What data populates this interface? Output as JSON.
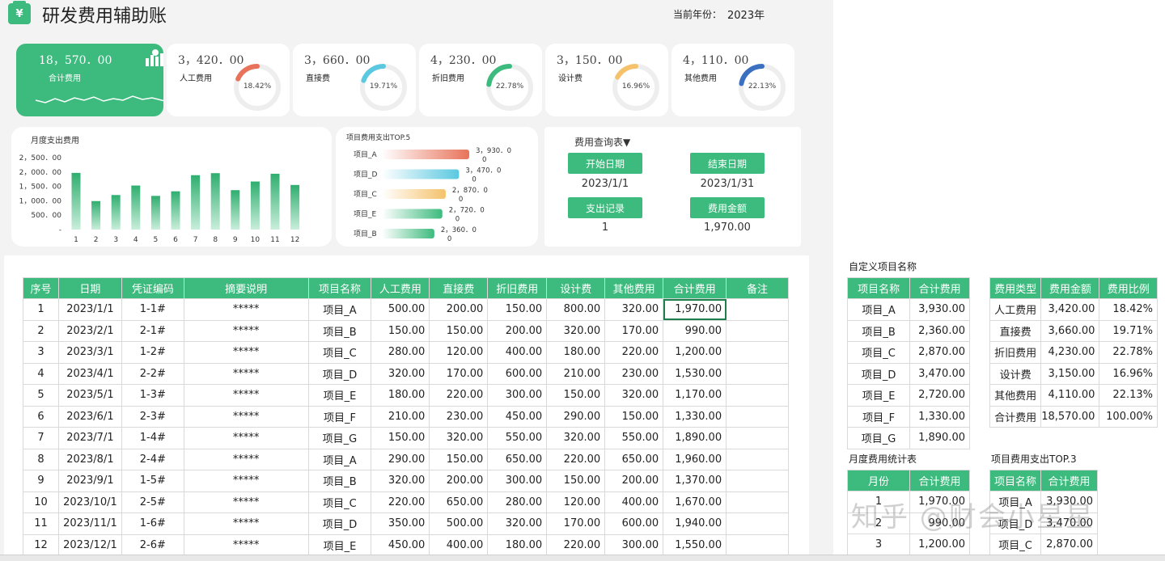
{
  "header": {
    "logo_glyph": "¥",
    "title": "研发费用辅助账",
    "year_label": "当前年份：",
    "year_value": "2023年"
  },
  "kpis": {
    "total": {
      "amount": "18，570．00",
      "label": "合计费用"
    },
    "items": [
      {
        "amount": "3，420．00",
        "label": "人工费用",
        "pct": "18.42%",
        "ratio": 0.1842,
        "color": "#e8735a"
      },
      {
        "amount": "3，660．00",
        "label": "直接费",
        "pct": "19.71%",
        "ratio": 0.1971,
        "color": "#5ac8e0"
      },
      {
        "amount": "4，230．00",
        "label": "折旧费用",
        "pct": "22.78%",
        "ratio": 0.2278,
        "color": "#3dbb7e"
      },
      {
        "amount": "3，150．00",
        "label": "设计费",
        "pct": "16.96%",
        "ratio": 0.1696,
        "color": "#f5c26b"
      },
      {
        "amount": "4，110．00",
        "label": "其他费用",
        "pct": "22.13%",
        "ratio": 0.2213,
        "color": "#3b6fc0"
      }
    ]
  },
  "chart_data": [
    {
      "type": "bar",
      "title": "月度支出费用",
      "categories": [
        "1",
        "2",
        "3",
        "4",
        "5",
        "6",
        "7",
        "8",
        "9",
        "10",
        "11",
        "12"
      ],
      "values": [
        1970,
        990,
        1200,
        1530,
        1170,
        1330,
        1890,
        1960,
        1370,
        1670,
        1940,
        1550
      ],
      "yticks": [
        "2，500．00",
        "2，000．00",
        "1，500．00",
        "1，000．00",
        "500．00",
        "-"
      ],
      "ylim": [
        0,
        2500
      ],
      "color": "#3dbb7e"
    },
    {
      "type": "bar",
      "orientation": "horizontal",
      "title": "项目费用支出TOP.5",
      "categories": [
        "项目_A",
        "项目_D",
        "项目_C",
        "项目_E",
        "项目_B"
      ],
      "values": [
        3930,
        3470,
        2870,
        2720,
        2360
      ],
      "value_labels": [
        [
          "3，930．0",
          "0"
        ],
        [
          "3，470．0",
          "0"
        ],
        [
          "2，870．0",
          "0"
        ],
        [
          "2，720．0",
          "0"
        ],
        [
          "2，360．0",
          "0"
        ]
      ],
      "colors": [
        "#e8735a",
        "#5ac8e0",
        "#f5c26b",
        "#3dbb7e",
        "#3dbb7e"
      ],
      "xlim": [
        0,
        3930
      ]
    }
  ],
  "query": {
    "title": "费用查询表▼",
    "start_label": "开始日期",
    "start_value": "2023/1/1",
    "end_label": "结束日期",
    "end_value": "2023/1/31",
    "records_label": "支出记录",
    "records_value": "1",
    "amount_label": "费用金额",
    "amount_value": "1,970.00"
  },
  "main_table": {
    "headers": [
      "序号",
      "日期",
      "凭证编码",
      "摘要说明",
      "项目名称",
      "人工费用",
      "直接费",
      "折旧费用",
      "设计费",
      "其他费用",
      "合计费用",
      "备注"
    ],
    "rows": [
      [
        "1",
        "2023/1/1",
        "1-1#",
        "*****",
        "项目_A",
        "500.00",
        "200.00",
        "150.00",
        "800.00",
        "320.00",
        "1,970.00",
        ""
      ],
      [
        "2",
        "2023/2/1",
        "2-1#",
        "*****",
        "项目_B",
        "150.00",
        "150.00",
        "200.00",
        "320.00",
        "170.00",
        "990.00",
        ""
      ],
      [
        "3",
        "2023/3/1",
        "1-2#",
        "*****",
        "项目_C",
        "280.00",
        "120.00",
        "400.00",
        "180.00",
        "220.00",
        "1,200.00",
        ""
      ],
      [
        "4",
        "2023/4/1",
        "2-2#",
        "*****",
        "项目_D",
        "320.00",
        "170.00",
        "600.00",
        "210.00",
        "230.00",
        "1,530.00",
        ""
      ],
      [
        "5",
        "2023/5/1",
        "1-3#",
        "*****",
        "项目_E",
        "180.00",
        "220.00",
        "300.00",
        "150.00",
        "320.00",
        "1,170.00",
        ""
      ],
      [
        "6",
        "2023/6/1",
        "2-3#",
        "*****",
        "项目_F",
        "210.00",
        "230.00",
        "450.00",
        "290.00",
        "150.00",
        "1,330.00",
        ""
      ],
      [
        "7",
        "2023/7/1",
        "1-4#",
        "*****",
        "项目_G",
        "150.00",
        "320.00",
        "550.00",
        "320.00",
        "550.00",
        "1,890.00",
        ""
      ],
      [
        "8",
        "2023/8/1",
        "2-4#",
        "*****",
        "项目_A",
        "290.00",
        "150.00",
        "650.00",
        "220.00",
        "650.00",
        "1,960.00",
        ""
      ],
      [
        "9",
        "2023/9/1",
        "1-5#",
        "*****",
        "项目_B",
        "320.00",
        "200.00",
        "300.00",
        "150.00",
        "200.00",
        "1,370.00",
        ""
      ],
      [
        "10",
        "2023/10/1",
        "2-5#",
        "*****",
        "项目_C",
        "220.00",
        "650.00",
        "280.00",
        "120.00",
        "400.00",
        "1,670.00",
        ""
      ],
      [
        "11",
        "2023/11/1",
        "1-6#",
        "*****",
        "项目_D",
        "350.00",
        "500.00",
        "320.00",
        "170.00",
        "600.00",
        "1,940.00",
        ""
      ],
      [
        "12",
        "2023/12/1",
        "2-6#",
        "*****",
        "项目_E",
        "450.00",
        "400.00",
        "180.00",
        "220.00",
        "300.00",
        "1,550.00",
        ""
      ]
    ]
  },
  "project_table": {
    "title": "自定义项目名称",
    "headers": [
      "项目名称",
      "合计费用"
    ],
    "rows": [
      [
        "项目_A",
        "3,930.00"
      ],
      [
        "项目_B",
        "2,360.00"
      ],
      [
        "项目_C",
        "2,870.00"
      ],
      [
        "项目_D",
        "3,470.00"
      ],
      [
        "项目_E",
        "2,720.00"
      ],
      [
        "项目_F",
        "1,330.00"
      ],
      [
        "项目_G",
        "1,890.00"
      ]
    ]
  },
  "type_table": {
    "headers": [
      "费用类型",
      "费用金额",
      "费用比例"
    ],
    "rows": [
      [
        "人工费用",
        "3,420.00",
        "18.42%"
      ],
      [
        "直接费",
        "3,660.00",
        "19.71%"
      ],
      [
        "折旧费用",
        "4,230.00",
        "22.78%"
      ],
      [
        "设计费",
        "3,150.00",
        "16.96%"
      ],
      [
        "其他费用",
        "4,110.00",
        "22.13%"
      ],
      [
        "合计费用",
        "18,570.00",
        "100.00%"
      ]
    ]
  },
  "month_table": {
    "title": "月度费用统计表",
    "headers": [
      "月份",
      "合计费用"
    ],
    "rows": [
      [
        "1",
        "1,970.00"
      ],
      [
        "2",
        "990.00"
      ],
      [
        "3",
        "1,200.00"
      ]
    ]
  },
  "top3_table": {
    "title": "项目费用支出TOP.3",
    "headers": [
      "项目名称",
      "合计费用"
    ],
    "rows": [
      [
        "项目_A",
        "3,930.00"
      ],
      [
        "项目_D",
        "3,470.00"
      ],
      [
        "项目_C",
        "2,870.00"
      ]
    ]
  },
  "watermark": "知乎 @财会小星星"
}
